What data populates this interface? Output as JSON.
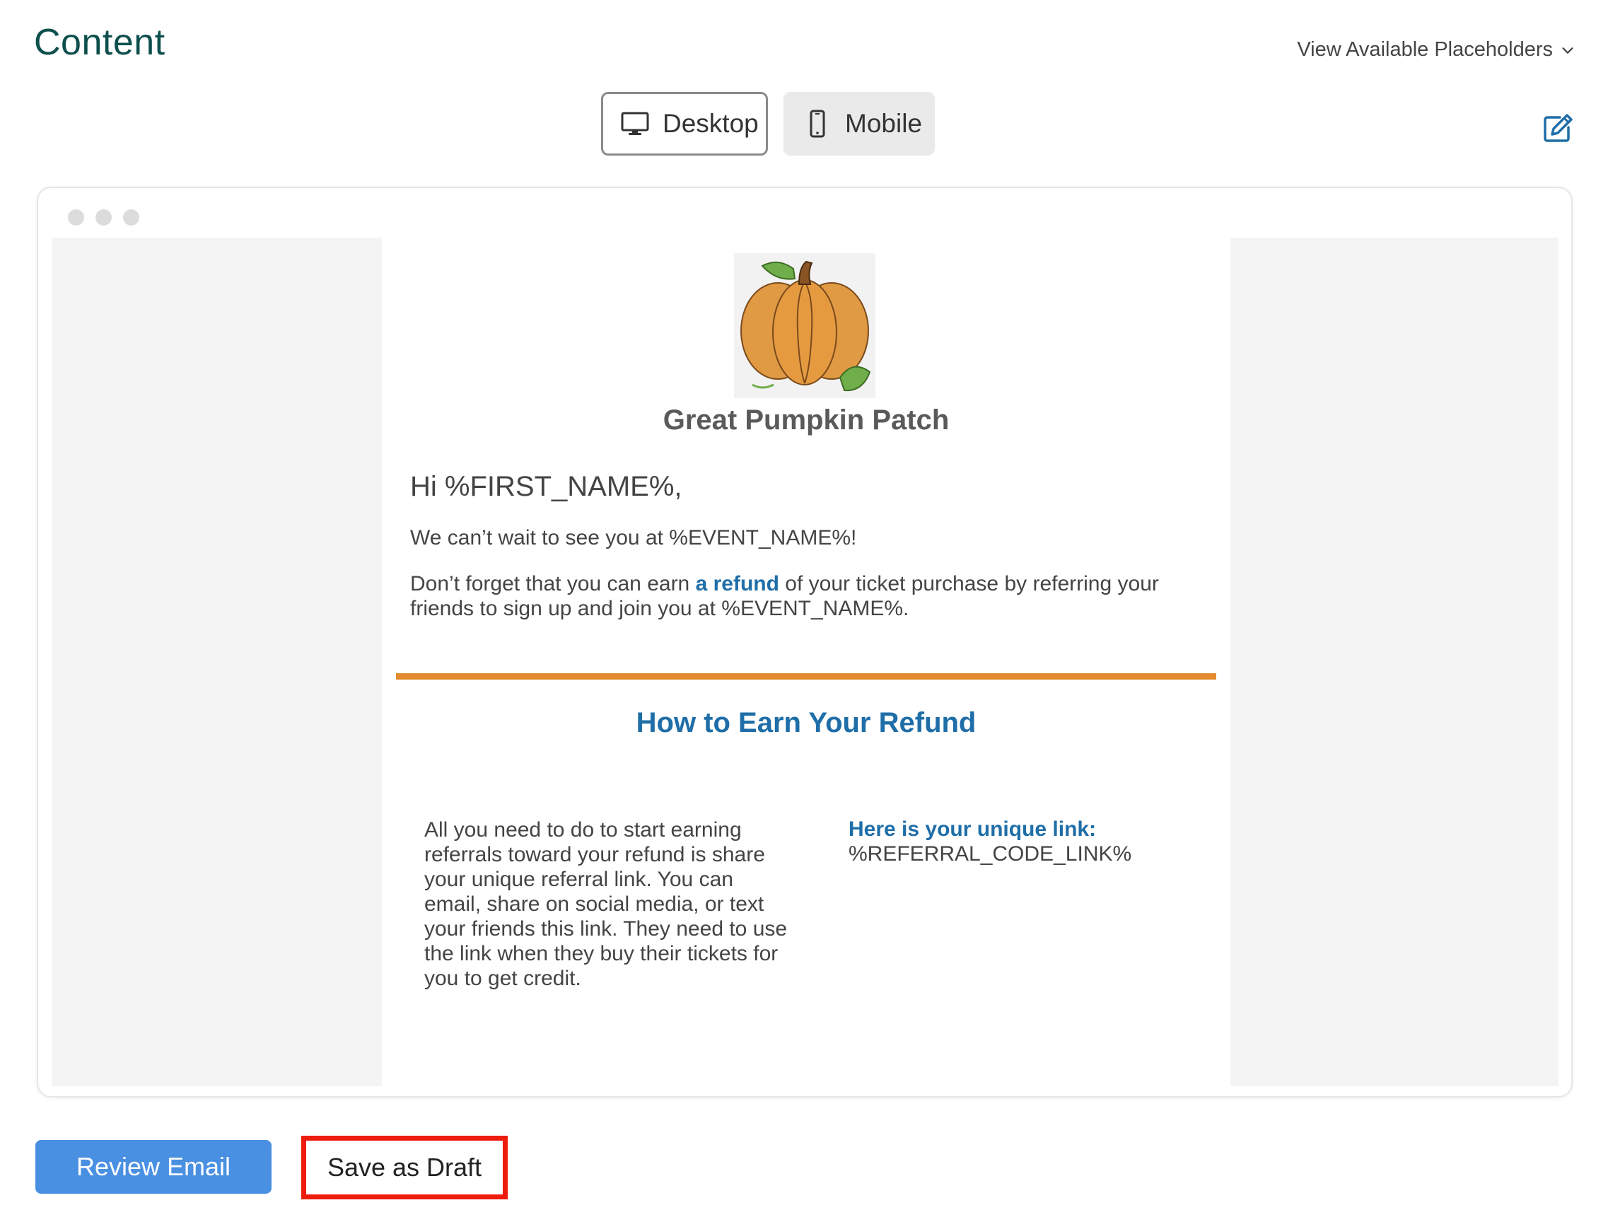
{
  "header": {
    "title": "Content",
    "placeholders_link": "View Available Placeholders"
  },
  "view_toggle": {
    "desktop_label": "Desktop",
    "mobile_label": "Mobile",
    "selected": "Desktop"
  },
  "email": {
    "brand_name": "Great Pumpkin Patch",
    "greeting": "Hi %FIRST_NAME%,",
    "paragraph1": "We can’t wait to see you at %EVENT_NAME%!",
    "paragraph2_before": "Don’t forget that you can earn ",
    "paragraph2_link": "a refund",
    "paragraph2_after": " of your ticket purchase by referring your friends to sign up and join you at %EVENT_NAME%.",
    "section_heading": "How to Earn Your Refund",
    "instructions": "All you need to do to start earning referrals toward your refund is share your unique referral link. You can email, share on social media, or text your friends this link. They need to use the link when they buy their tickets for you to get credit.",
    "link_label": "Here is your unique link:",
    "link_value": "%REFERRAL_CODE_LINK%"
  },
  "actions": {
    "review_label": "Review Email",
    "draft_label": "Save as Draft"
  },
  "colors": {
    "title": "#0d4f4d",
    "link_blue": "#1f6ea8",
    "divider_orange": "#e38a2e",
    "review_button": "#4a90e2",
    "highlight_red": "#ee1c0c"
  },
  "icons": [
    "chevron-down-icon",
    "desktop-monitor-icon",
    "mobile-phone-icon",
    "edit-icon",
    "pumpkin-logo"
  ]
}
